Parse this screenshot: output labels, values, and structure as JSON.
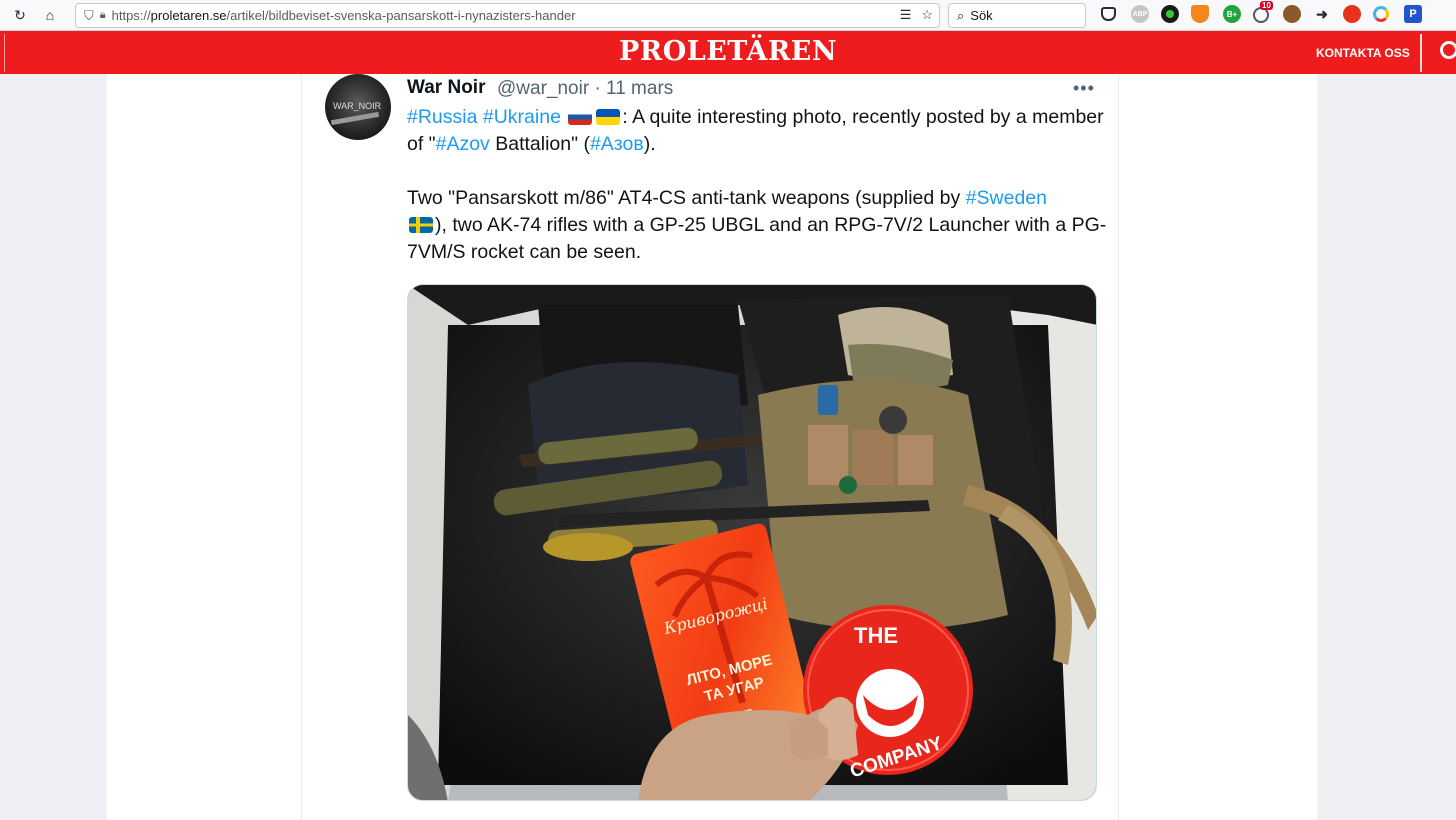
{
  "browser": {
    "url_prefix": "https://",
    "url_domain": "proletaren.se",
    "url_path": "/artikel/bildbeviset-svenska-pansarskott-i-nynazisters-hander",
    "search_placeholder": "Sök",
    "badge_count": "10"
  },
  "site": {
    "logo": "PROLETÄREN",
    "contact": "KONTAKTA OSS"
  },
  "tweet": {
    "name": "War Noir",
    "handle": "@war_noir",
    "date": "· 11 mars",
    "avatar_text": "WAR_NOIR",
    "tag_russia": "#Russia",
    "tag_ukraine": "#Ukraine",
    "line1_rest": ": A quite interesting photo, recently posted by a member of \"",
    "tag_azov": "#Azov",
    "line1_mid": " Battalion\" (",
    "tag_azov_cyr": "#Азов",
    "line1_end": ").",
    "para2_start": "Two \"Pansarskott m/86\" AT4-CS anti-tank weapons (supplied by ",
    "tag_sweden": "#Sweden",
    "para2_end": "), two AK-74 rifles with a GP-25 UBGL and an RPG-7V/2 Launcher with a PG-7VM/S rocket can be seen.",
    "more": "•••"
  },
  "photo": {
    "card_text_1": "Криворожці",
    "card_text_2": "ЛІТО, МОРЕ",
    "card_text_3": "ТА УГАР",
    "card_letter": "K",
    "sticker_top": "THE",
    "sticker_bottom": "COMPANY"
  }
}
